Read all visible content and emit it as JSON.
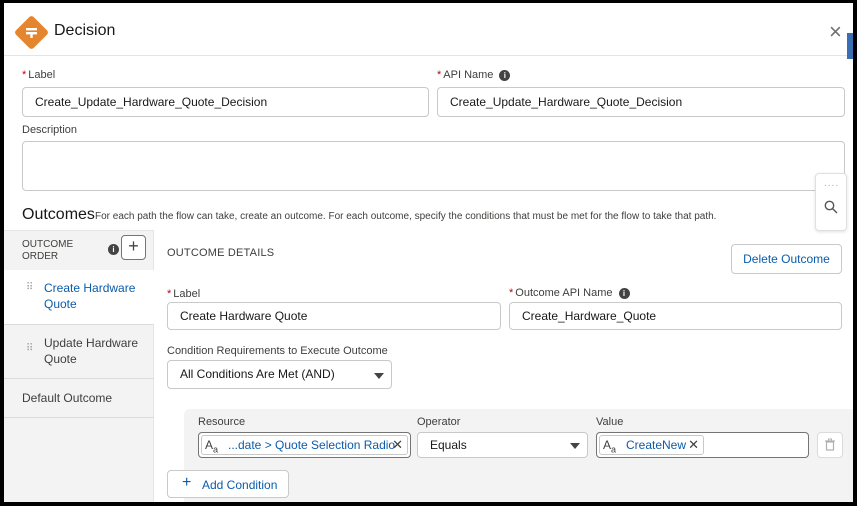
{
  "header": {
    "title": "Decision",
    "close_label": "×"
  },
  "form": {
    "label_caption": "Label",
    "label_value": "Create_Update_Hardware_Quote_Decision",
    "api_caption": "API Name",
    "api_value": "Create_Update_Hardware_Quote_Decision",
    "description_caption": "Description",
    "description_value": "",
    "required_mark": "*",
    "info_glyph": "i"
  },
  "outcomes": {
    "title": "Outcomes",
    "description": "For each path the flow can take, create an outcome. For each outcome, specify the conditions that must be met for the flow to take that path.",
    "order_header_line1": "OUTCOME",
    "order_header_line2": "ORDER",
    "add_label": "+",
    "items": [
      {
        "line1": "Create Hardware",
        "line2": "Quote",
        "active": true
      },
      {
        "line1": "Update Hardware",
        "line2": "Quote",
        "active": false
      }
    ],
    "default_label": "Default Outcome",
    "grip_glyph": "⠿"
  },
  "details": {
    "header": "OUTCOME DETAILS",
    "delete_button": "Delete Outcome",
    "label_caption": "Label",
    "label_value": "Create Hardware Quote",
    "api_caption": "Outcome API Name",
    "api_value": "Create_Hardware_Quote",
    "requirements_caption": "Condition Requirements to Execute Outcome",
    "requirements_value": "All Conditions Are Met (AND)"
  },
  "condition": {
    "resource_caption": "Resource",
    "resource_value": "...date > Quote Selection Radio",
    "operator_caption": "Operator",
    "operator_value": "Equals",
    "value_caption": "Value",
    "value_value": "CreateNew",
    "aa_glyph": "A",
    "aa_sub": "a",
    "remove_glyph": "✕",
    "add_condition": "Add Condition",
    "add_glyph": "+"
  },
  "tools": {
    "dots": "....",
    "search_icon": "search-icon"
  },
  "colors": {
    "accent": "#0b5cab",
    "decision_icon": "#e5862f",
    "required": "#ba0517"
  }
}
